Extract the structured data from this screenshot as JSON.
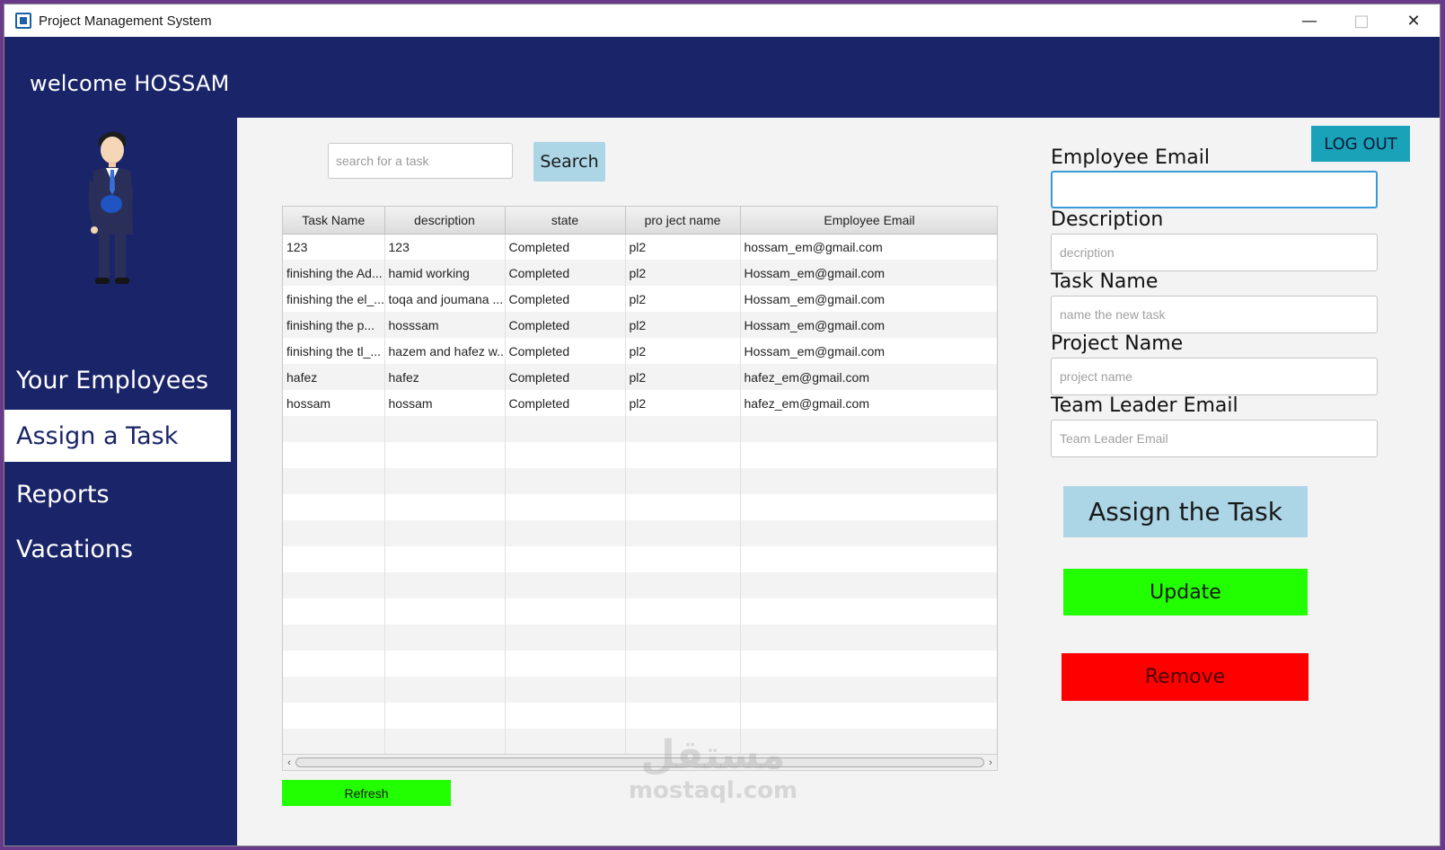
{
  "window": {
    "title": "Project Management System"
  },
  "header": {
    "welcome": "welcome HOSSAM"
  },
  "sidebar": {
    "items": [
      {
        "label": "Your Employees"
      },
      {
        "label": "Assign a Task"
      },
      {
        "label": "Reports"
      },
      {
        "label": "Vacations"
      }
    ],
    "active": "Assign a Task"
  },
  "search": {
    "placeholder": "search for a task",
    "button_label": "Search"
  },
  "table": {
    "columns": [
      "Task Name",
      "description",
      "state",
      "pro ject name",
      "Employee Email"
    ],
    "rows": [
      [
        "123",
        "123",
        "Completed",
        "pl2",
        "hossam_em@gmail.com"
      ],
      [
        "finishing the Ad...",
        "hamid working",
        "Completed",
        "pl2",
        "Hossam_em@gmail.com"
      ],
      [
        "finishing the el_...",
        "toqa and joumana ...",
        "Completed",
        "pl2",
        "Hossam_em@gmail.com"
      ],
      [
        "finishing the p...",
        "hosssam",
        "Completed",
        "pl2",
        "Hossam_em@gmail.com"
      ],
      [
        "finishing the tl_...",
        "hazem and hafez w...",
        "Completed",
        "pl2",
        "Hossam_em@gmail.com"
      ],
      [
        "hafez",
        "hafez",
        "Completed",
        "pl2",
        "hafez_em@gmail.com"
      ],
      [
        "hossam",
        "hossam",
        "Completed",
        "pl2",
        "hafez_em@gmail.com"
      ]
    ]
  },
  "refresh_label": "Refresh",
  "logout_label": "LOG OUT",
  "form": {
    "employee_email": {
      "label": "Employee Email",
      "value": "",
      "placeholder": ""
    },
    "description": {
      "label": "Description",
      "placeholder": "decription"
    },
    "task_name": {
      "label": "Task Name",
      "placeholder": "name the new task"
    },
    "project_name": {
      "label": "Project Name",
      "placeholder": "project name"
    },
    "team_leader_email": {
      "label": "Team Leader Email",
      "placeholder": "Team Leader Email"
    }
  },
  "actions": {
    "assign_label": "Assign the Task",
    "update_label": "Update",
    "remove_label": "Remove"
  },
  "watermark": {
    "arabic": "مستقل",
    "latin": "mostaql.com"
  },
  "colors": {
    "navy": "#1a2468",
    "green": "#22ff00",
    "red": "#ff0000",
    "light_blue": "#acd5e6",
    "teal": "#1aa2b8"
  }
}
